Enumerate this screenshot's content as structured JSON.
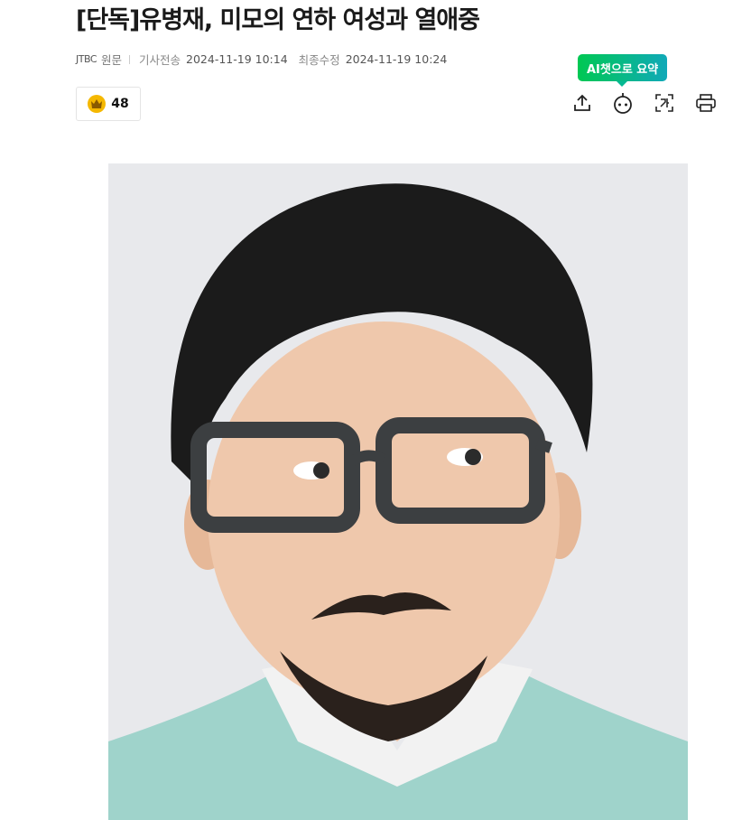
{
  "article": {
    "headline": "[단독]유병재, 미모의 연하 여성과 열애중",
    "press": "JTBC",
    "origin_link": "원문",
    "sent_label": "기사전송",
    "sent_time": "2024-11-19 10:14",
    "modified_label": "최종수정",
    "modified_time": "2024-11-19 10:24"
  },
  "reaction": {
    "icon": "crown-emoji-icon",
    "count": "48"
  },
  "toolbar": {
    "ai_summary_label": "AI챗으로 요약",
    "ai_gradient": [
      "#00c853",
      "#10a9b8"
    ],
    "icons": [
      "share-icon",
      "ai-chat-icon",
      "translate-icon",
      "print-icon"
    ]
  }
}
